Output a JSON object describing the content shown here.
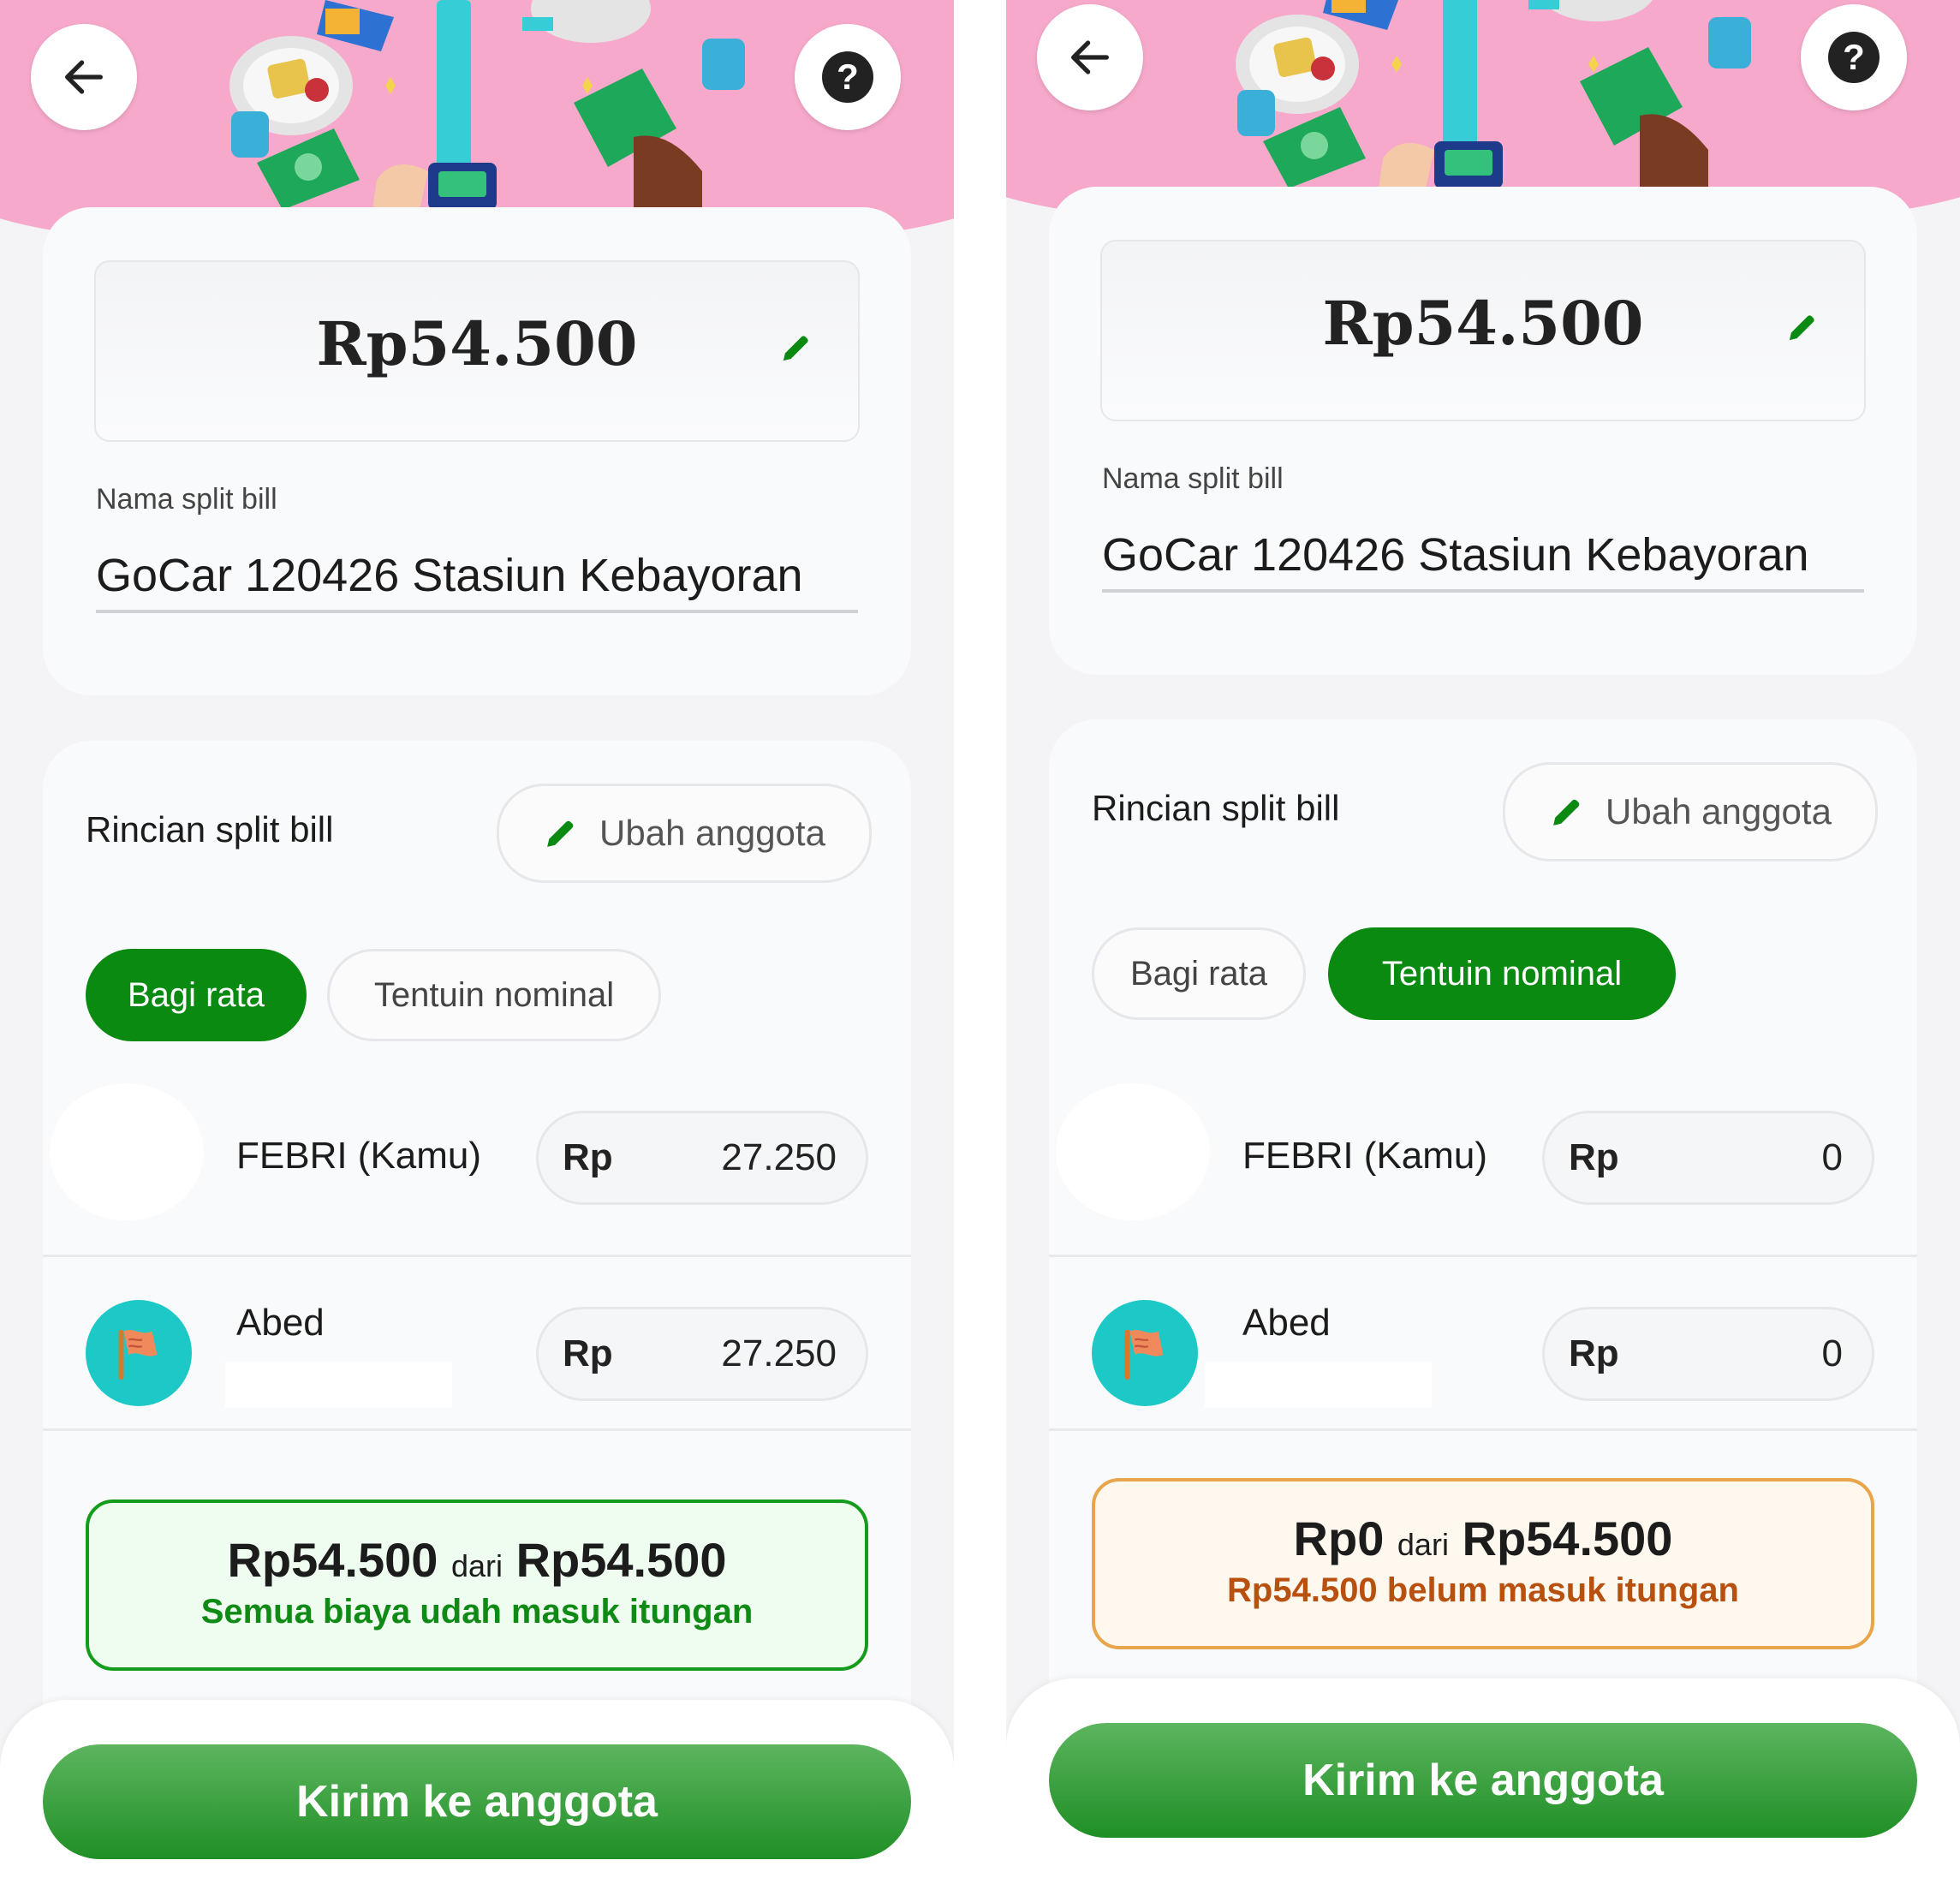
{
  "colors": {
    "accent_green": "#0b8a12",
    "hero_pink": "#f7a9cb",
    "ok_border": "#149c1c",
    "warn_border": "#e9a54b",
    "avatar_teal": "#1dc9c7"
  },
  "icons": {
    "back": "arrow-left-icon",
    "help": "question-mark-icon",
    "edit": "pencil-icon",
    "avatar": "flag-icon"
  },
  "screens": [
    {
      "total_amount": "Rp54.500",
      "split_name_label": "Nama split bill",
      "split_name_value": "GoCar 120426 Stasiun Kebayoran",
      "details_title": "Rincian split bill",
      "change_members_label": "Ubah anggota",
      "tabs": [
        {
          "label": "Bagi rata",
          "active": true
        },
        {
          "label": "Tentuin nominal",
          "active": false
        }
      ],
      "members": [
        {
          "name": "FEBRI (Kamu)",
          "currency": "Rp",
          "amount": "27.250"
        },
        {
          "name": "Abed",
          "currency": "Rp",
          "amount": "27.250"
        }
      ],
      "summary": {
        "assigned": "Rp54.500",
        "dari": "dari",
        "total": "Rp54.500",
        "message": "Semua biaya udah masuk itungan",
        "state": "ok"
      },
      "cta_label": "Kirim ke anggota"
    },
    {
      "total_amount": "Rp54.500",
      "split_name_label": "Nama split bill",
      "split_name_value": "GoCar 120426 Stasiun Kebayoran",
      "details_title": "Rincian split bill",
      "change_members_label": "Ubah anggota",
      "tabs": [
        {
          "label": "Bagi rata",
          "active": false
        },
        {
          "label": "Tentuin nominal",
          "active": true
        }
      ],
      "members": [
        {
          "name": "FEBRI (Kamu)",
          "currency": "Rp",
          "amount": "0"
        },
        {
          "name": "Abed",
          "currency": "Rp",
          "amount": "0"
        }
      ],
      "summary": {
        "assigned": "Rp0",
        "dari": "dari",
        "total": "Rp54.500",
        "message": "Rp54.500 belum masuk itungan",
        "state": "warn"
      },
      "cta_label": "Kirim ke anggota"
    }
  ]
}
